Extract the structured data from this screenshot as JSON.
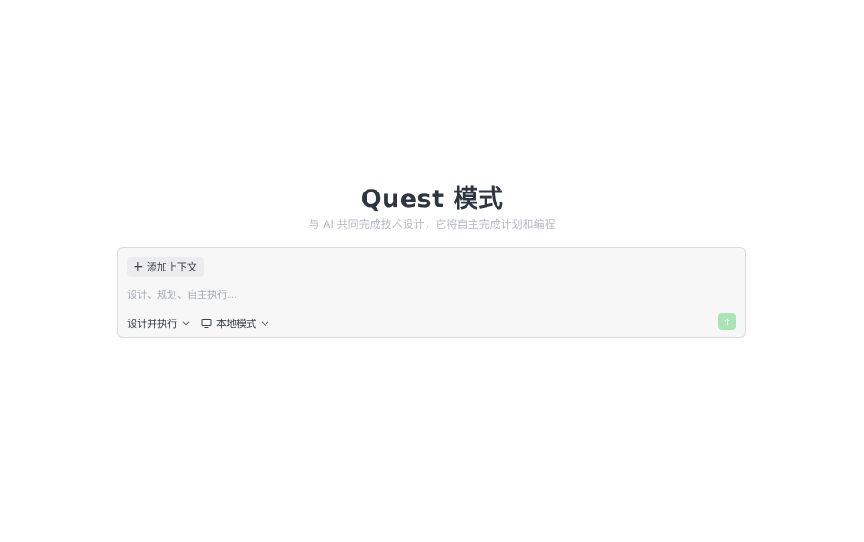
{
  "hero": {
    "title": "Quest 模式",
    "subtitle": "与 AI 共同完成技术设计，它将自主完成计划和编程"
  },
  "composer": {
    "context_chip": {
      "icon": "plus-icon",
      "label": "添加上下文"
    },
    "prompt": {
      "placeholder": "设计、规划、自主执行...",
      "value": ""
    },
    "toolbar": {
      "mode_dropdown": {
        "label": "设计并执行",
        "icon": "chevron-down-icon"
      },
      "env_dropdown": {
        "icon": "monitor-icon",
        "label": "本地模式",
        "chevron": "chevron-down-icon"
      }
    },
    "send_button": {
      "icon": "arrow-up-icon",
      "color": "#a9e3b6",
      "state": "disabled"
    }
  },
  "colors": {
    "title": "#2f3640",
    "subtitle": "#b7bcc3",
    "composer_bg": "#f7f7f8",
    "composer_border": "#dcdde0",
    "accent": "#a9e3b6"
  }
}
